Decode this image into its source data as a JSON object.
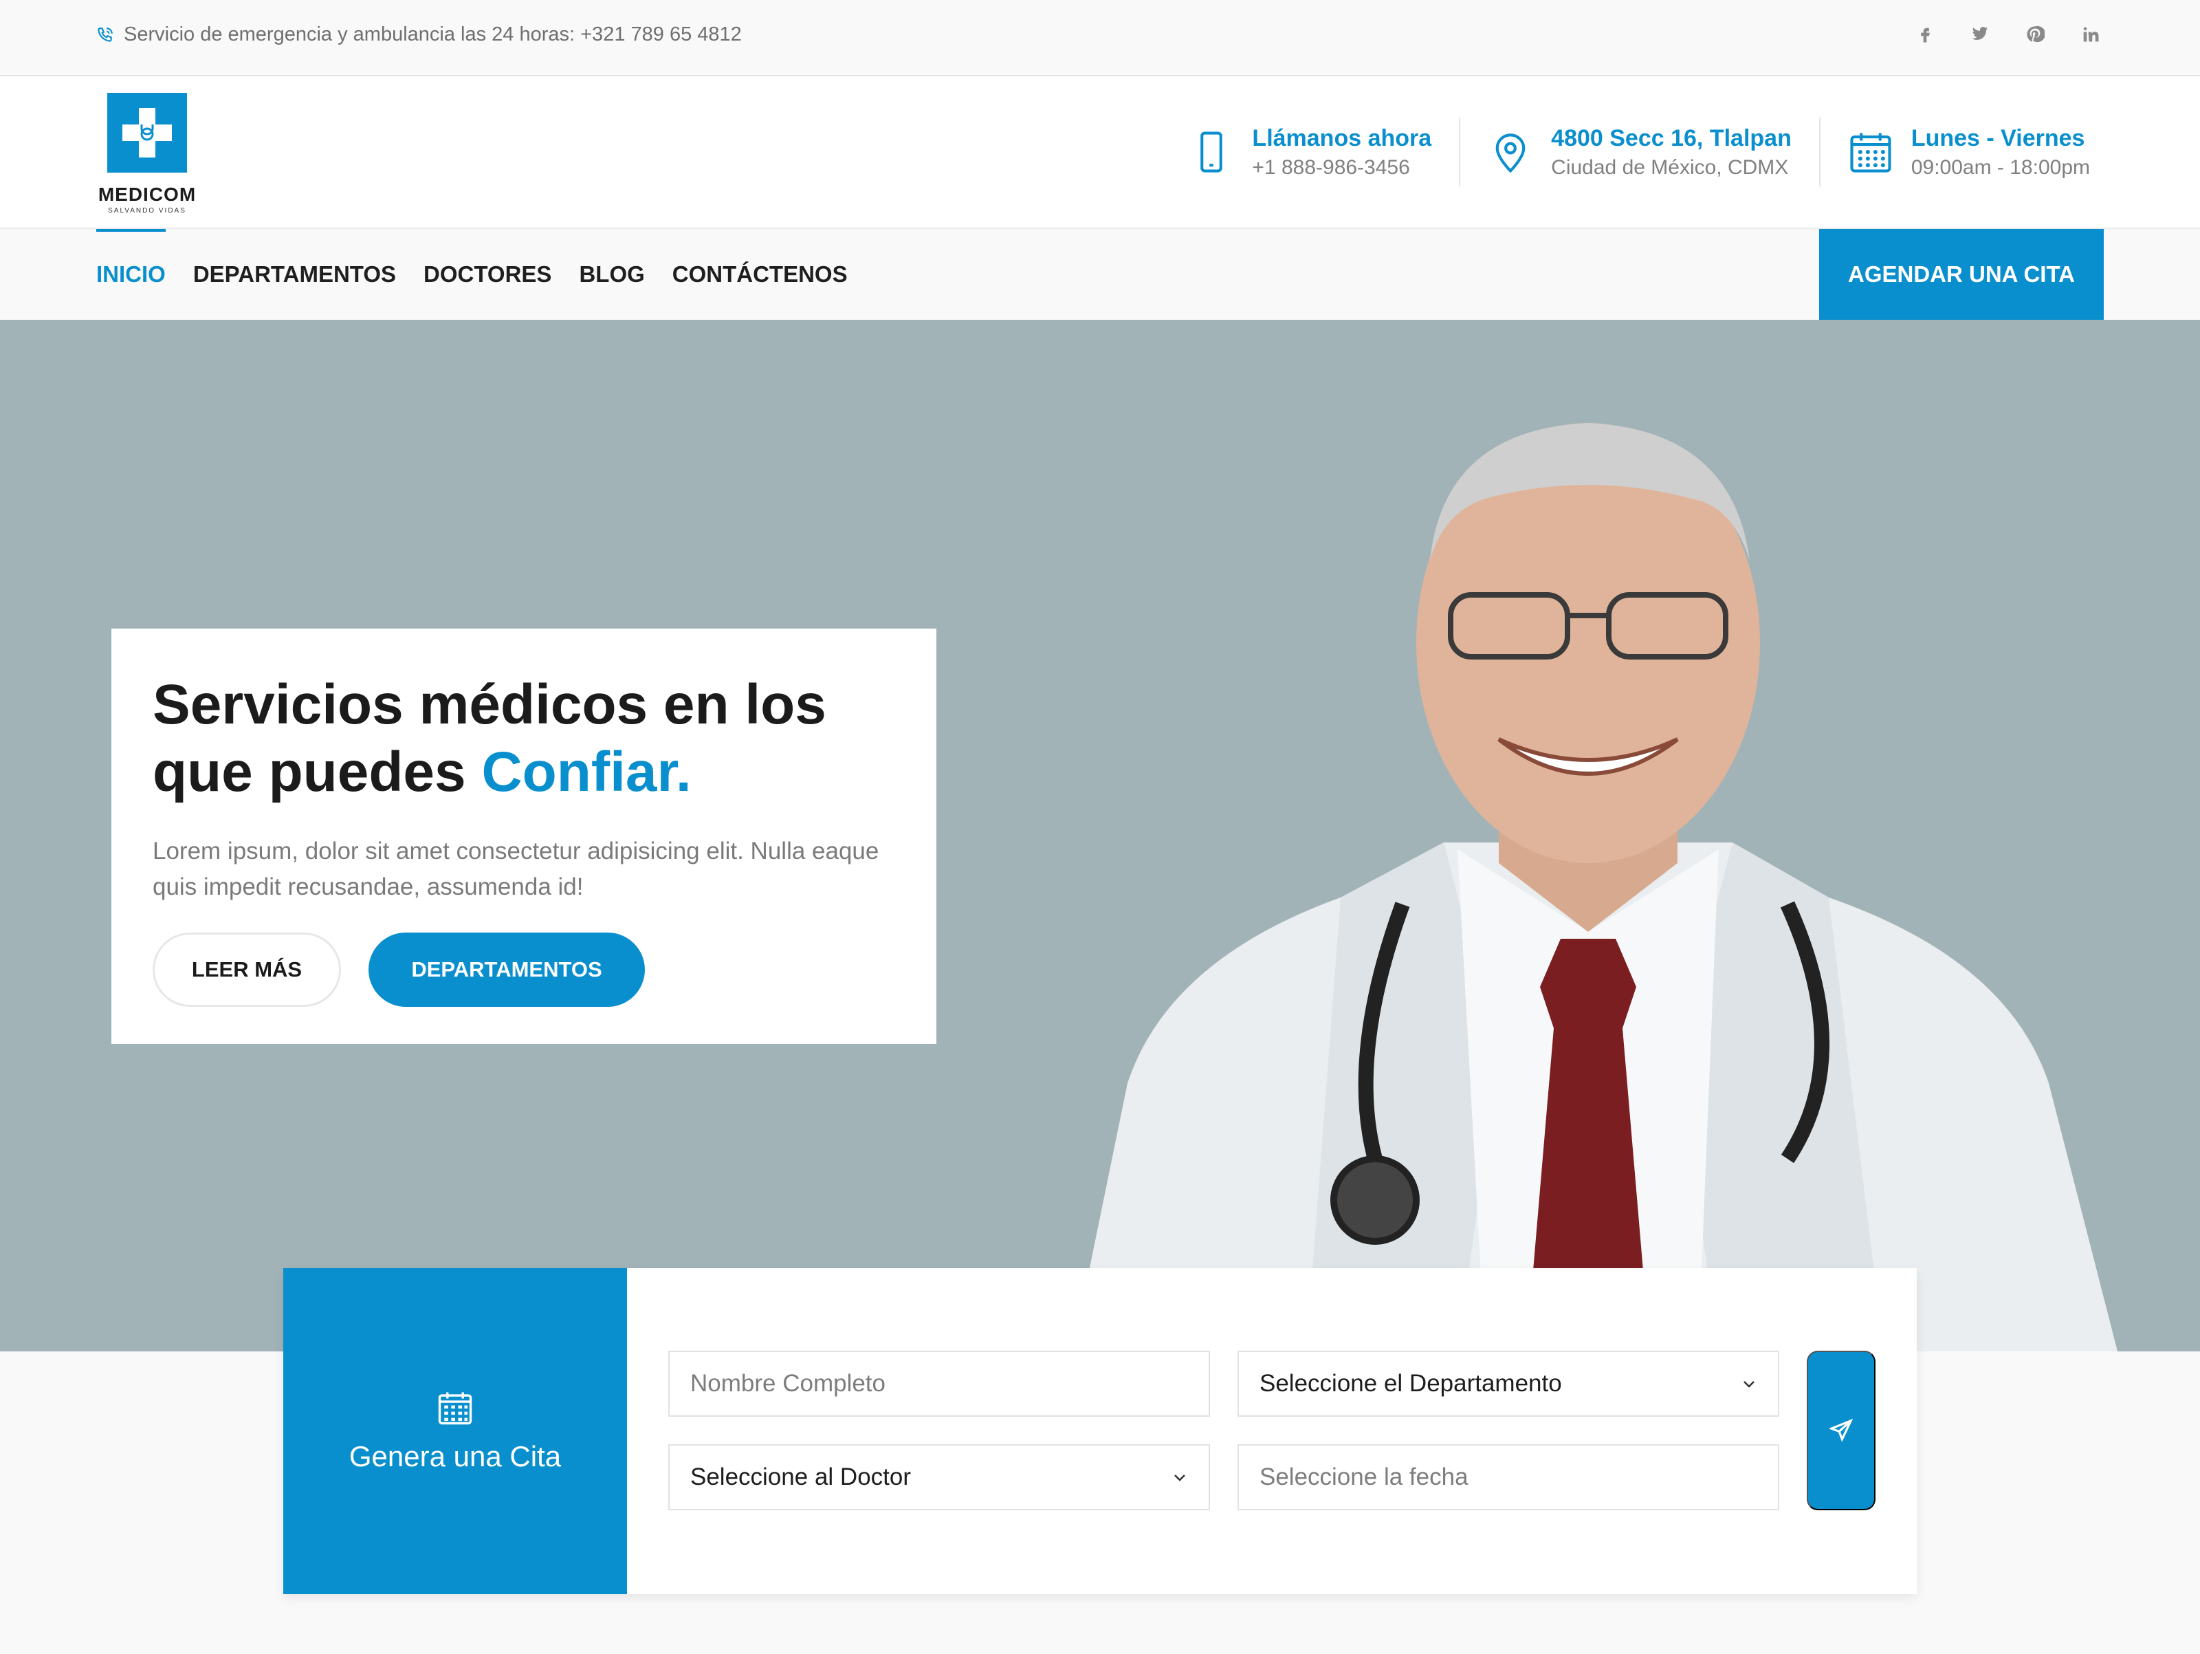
{
  "topbar": {
    "emergency_text": "Servicio de emergencia y ambulancia las 24 horas: +321 789 65 4812",
    "social": [
      "facebook-icon",
      "twitter-icon",
      "pinterest-icon",
      "linkedin-icon"
    ]
  },
  "logo": {
    "name": "MEDICOM",
    "tagline": "SALVANDO VIDAS"
  },
  "header_info": [
    {
      "icon": "phone-icon",
      "title": "Llámanos ahora",
      "sub": "+1 888-986-3456"
    },
    {
      "icon": "location-pin-icon",
      "title": "4800 Secc 16, Tlalpan",
      "sub": "Ciudad de México, CDMX"
    },
    {
      "icon": "calendar-icon",
      "title": "Lunes - Viernes",
      "sub": "09:00am - 18:00pm"
    }
  ],
  "nav": {
    "items": [
      "INICIO",
      "DEPARTAMENTOS",
      "DOCTORES",
      "BLOG",
      "CONTÁCTENOS"
    ],
    "active": "INICIO",
    "cta": "AGENDAR UNA CITA"
  },
  "hero": {
    "title_part1": "Servicios médicos en los",
    "title_part2": "que puedes ",
    "title_accent": "Confiar.",
    "text": "Lorem ipsum, dolor sit amet consectetur adipisicing elit. Nulla eaque quis impedit recusandae, assumenda id!",
    "btn_primary": "LEER MÁS",
    "btn_secondary": "DEPARTAMENTOS"
  },
  "appointment": {
    "title": "Genera una Cita",
    "name_placeholder": "Nombre Completo",
    "department_select": "Seleccione el Departamento",
    "doctor_select": "Seleccione al Doctor",
    "date_placeholder": "Seleccione la fecha"
  },
  "colors": {
    "accent": "#0a8fce",
    "hero_bg": "#a2b3b7",
    "text_dark": "#1b1b1b",
    "text_muted": "#7a7a7a"
  }
}
